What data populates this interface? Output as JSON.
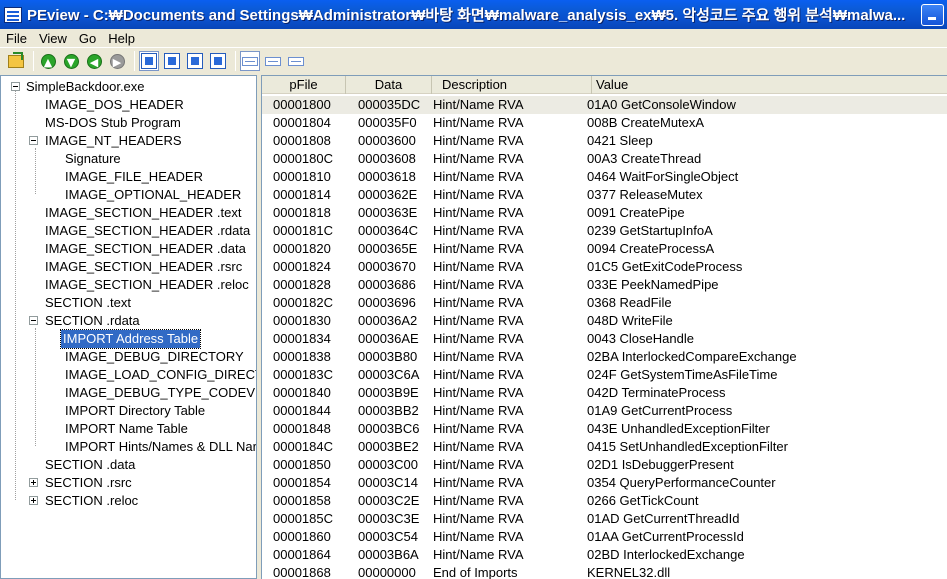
{
  "window": {
    "title": "PEview - C:₩Documents and Settings₩Administrator₩바탕 화면₩malware_analysis_ex₩5. 악성코드 주요 행위 분석₩malwa..."
  },
  "menu": [
    {
      "label": "File"
    },
    {
      "label": "View"
    },
    {
      "label": "Go"
    },
    {
      "label": "Help"
    }
  ],
  "toolbar": {
    "icons": [
      "open-folder-icon",
      "back-icon",
      "forward-icon",
      "up-icon",
      "next-icon",
      "view-byte-icon",
      "view-word-icon",
      "view-dword-icon",
      "view-address-icon",
      "view-list-icon",
      "view-hex-icon",
      "view-text-icon"
    ]
  },
  "tree": {
    "items": [
      {
        "label": "SimpleBackdoor.exe"
      },
      {
        "label": "IMAGE_DOS_HEADER"
      },
      {
        "label": "MS-DOS Stub Program"
      },
      {
        "label": "IMAGE_NT_HEADERS"
      },
      {
        "label": "Signature"
      },
      {
        "label": "IMAGE_FILE_HEADER"
      },
      {
        "label": "IMAGE_OPTIONAL_HEADER"
      },
      {
        "label": "IMAGE_SECTION_HEADER .text"
      },
      {
        "label": "IMAGE_SECTION_HEADER .rdata"
      },
      {
        "label": "IMAGE_SECTION_HEADER .data"
      },
      {
        "label": "IMAGE_SECTION_HEADER .rsrc"
      },
      {
        "label": "IMAGE_SECTION_HEADER .reloc"
      },
      {
        "label": "SECTION .text"
      },
      {
        "label": "SECTION .rdata"
      },
      {
        "label": "IMPORT Address Table"
      },
      {
        "label": "IMAGE_DEBUG_DIRECTORY"
      },
      {
        "label": "IMAGE_LOAD_CONFIG_DIRECT"
      },
      {
        "label": "IMAGE_DEBUG_TYPE_CODEVI"
      },
      {
        "label": "IMPORT Directory Table"
      },
      {
        "label": "IMPORT Name Table"
      },
      {
        "label": "IMPORT Hints/Names & DLL Nar"
      },
      {
        "label": "SECTION .data"
      },
      {
        "label": "SECTION .rsrc"
      },
      {
        "label": "SECTION .reloc"
      }
    ]
  },
  "list": {
    "columns": [
      "pFile",
      "Data",
      "Description",
      "Value"
    ],
    "rows": [
      {
        "pfile": "00001800",
        "data": "000035DC",
        "desc": "Hint/Name RVA",
        "value": "01A0  GetConsoleWindow"
      },
      {
        "pfile": "00001804",
        "data": "000035F0",
        "desc": "Hint/Name RVA",
        "value": "008B  CreateMutexA"
      },
      {
        "pfile": "00001808",
        "data": "00003600",
        "desc": "Hint/Name RVA",
        "value": "0421  Sleep"
      },
      {
        "pfile": "0000180C",
        "data": "00003608",
        "desc": "Hint/Name RVA",
        "value": "00A3  CreateThread"
      },
      {
        "pfile": "00001810",
        "data": "00003618",
        "desc": "Hint/Name RVA",
        "value": "0464  WaitForSingleObject"
      },
      {
        "pfile": "00001814",
        "data": "0000362E",
        "desc": "Hint/Name RVA",
        "value": "0377  ReleaseMutex"
      },
      {
        "pfile": "00001818",
        "data": "0000363E",
        "desc": "Hint/Name RVA",
        "value": "0091  CreatePipe"
      },
      {
        "pfile": "0000181C",
        "data": "0000364C",
        "desc": "Hint/Name RVA",
        "value": "0239  GetStartupInfoA"
      },
      {
        "pfile": "00001820",
        "data": "0000365E",
        "desc": "Hint/Name RVA",
        "value": "0094  CreateProcessA"
      },
      {
        "pfile": "00001824",
        "data": "00003670",
        "desc": "Hint/Name RVA",
        "value": "01C5  GetExitCodeProcess"
      },
      {
        "pfile": "00001828",
        "data": "00003686",
        "desc": "Hint/Name RVA",
        "value": "033E  PeekNamedPipe"
      },
      {
        "pfile": "0000182C",
        "data": "00003696",
        "desc": "Hint/Name RVA",
        "value": "0368  ReadFile"
      },
      {
        "pfile": "00001830",
        "data": "000036A2",
        "desc": "Hint/Name RVA",
        "value": "048D  WriteFile"
      },
      {
        "pfile": "00001834",
        "data": "000036AE",
        "desc": "Hint/Name RVA",
        "value": "0043  CloseHandle"
      },
      {
        "pfile": "00001838",
        "data": "00003B80",
        "desc": "Hint/Name RVA",
        "value": "02BA  InterlockedCompareExchange"
      },
      {
        "pfile": "0000183C",
        "data": "00003C6A",
        "desc": "Hint/Name RVA",
        "value": "024F  GetSystemTimeAsFileTime"
      },
      {
        "pfile": "00001840",
        "data": "00003B9E",
        "desc": "Hint/Name RVA",
        "value": "042D  TerminateProcess"
      },
      {
        "pfile": "00001844",
        "data": "00003BB2",
        "desc": "Hint/Name RVA",
        "value": "01A9  GetCurrentProcess"
      },
      {
        "pfile": "00001848",
        "data": "00003BC6",
        "desc": "Hint/Name RVA",
        "value": "043E  UnhandledExceptionFilter"
      },
      {
        "pfile": "0000184C",
        "data": "00003BE2",
        "desc": "Hint/Name RVA",
        "value": "0415  SetUnhandledExceptionFilter"
      },
      {
        "pfile": "00001850",
        "data": "00003C00",
        "desc": "Hint/Name RVA",
        "value": "02D1  IsDebuggerPresent"
      },
      {
        "pfile": "00001854",
        "data": "00003C14",
        "desc": "Hint/Name RVA",
        "value": "0354  QueryPerformanceCounter"
      },
      {
        "pfile": "00001858",
        "data": "00003C2E",
        "desc": "Hint/Name RVA",
        "value": "0266  GetTickCount"
      },
      {
        "pfile": "0000185C",
        "data": "00003C3E",
        "desc": "Hint/Name RVA",
        "value": "01AD  GetCurrentThreadId"
      },
      {
        "pfile": "00001860",
        "data": "00003C54",
        "desc": "Hint/Name RVA",
        "value": "01AA  GetCurrentProcessId"
      },
      {
        "pfile": "00001864",
        "data": "00003B6A",
        "desc": "Hint/Name RVA",
        "value": "02BD  InterlockedExchange"
      },
      {
        "pfile": "00001868",
        "data": "00000000",
        "desc": "End of Imports",
        "value": "KERNEL32.dll"
      }
    ]
  }
}
